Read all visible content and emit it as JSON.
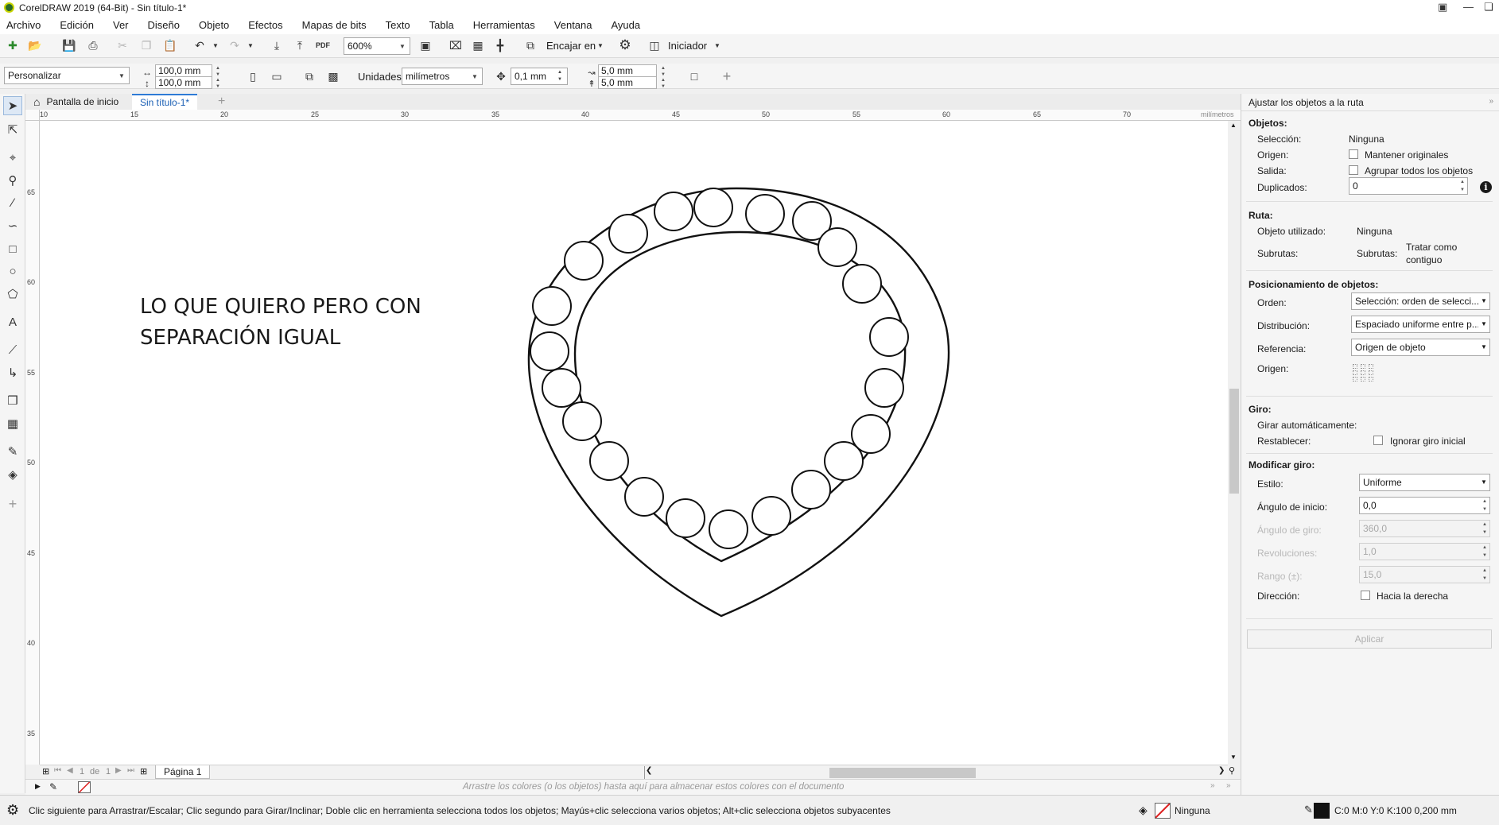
{
  "window": {
    "title": "CorelDRAW 2019 (64-Bit) - Sin título-1*"
  },
  "menu": [
    "Archivo",
    "Edición",
    "Ver",
    "Diseño",
    "Objeto",
    "Efectos",
    "Mapas de bits",
    "Texto",
    "Tabla",
    "Herramientas",
    "Ventana",
    "Ayuda"
  ],
  "toolbar": {
    "zoom": "600%",
    "pdf_label": "PDF",
    "snap_label": "Encajar en",
    "launcher_label": "Iniciador"
  },
  "property_bar": {
    "preset": "Personalizar",
    "width": "100,0 mm",
    "height": "100,0 mm",
    "units_label": "Unidades:",
    "units_value": "milímetros",
    "nudge": "0,1 mm",
    "dup_x": "5,0 mm",
    "dup_y": "5,0 mm"
  },
  "tabs": {
    "home": "Pantalla de inicio",
    "document": "Sin título-1*"
  },
  "ruler": {
    "h_ticks": [
      "10",
      "15",
      "20",
      "25",
      "30",
      "35",
      "40",
      "45",
      "50",
      "55",
      "60",
      "65",
      "70"
    ],
    "units": "milímetros",
    "v_ticks": [
      "65",
      "60",
      "55",
      "50",
      "45",
      "40",
      "35"
    ]
  },
  "canvas": {
    "line1": "LO QUE QUIERO PERO CON",
    "line2": "SEPARACIÓN IGUAL"
  },
  "page_nav": {
    "current": "1",
    "of": "de",
    "total": "1",
    "page_tab": "Página 1"
  },
  "palette_hint": "Arrastre los colores (o los objetos) hasta aquí para almacenar estos colores con el documento",
  "status": {
    "hint": "Clic siguiente para Arrastrar/Escalar; Clic segundo para Girar/Inclinar; Doble clic en herramienta selecciona todos los objetos; Mayús+clic selecciona varios objetos; Alt+clic selecciona objetos subyacentes",
    "fill": "Ninguna",
    "outline": "C:0 M:0 Y:0 K:100  0,200 mm"
  },
  "docker": {
    "title": "Ajustar los objetos a la ruta",
    "objetos": {
      "heading": "Objetos:",
      "seleccion_label": "Selección:",
      "seleccion_value": "Ninguna",
      "origen_label": "Origen:",
      "origen_check": "Mantener originales",
      "salida_label": "Salida:",
      "salida_check": "Agrupar todos los objetos",
      "duplicados_label": "Duplicados:",
      "duplicados_value": "0"
    },
    "ruta": {
      "heading": "Ruta:",
      "objeto_label": "Objeto utilizado:",
      "objeto_value": "Ninguna",
      "subrutas_label": "Subrutas:",
      "subrutas_label2": "Subrutas:",
      "subrutas_value1": "Tratar como",
      "subrutas_value2": "contiguo"
    },
    "posicionamiento": {
      "heading": "Posicionamiento de objetos:",
      "orden_label": "Orden:",
      "orden_value": "Selección: orden de selecci...",
      "distribucion_label": "Distribución:",
      "distribucion_value": "Espaciado uniforme entre p...",
      "referencia_label": "Referencia:",
      "referencia_value": "Origen de objeto",
      "origen_label": "Origen:"
    },
    "giro": {
      "heading": "Giro:",
      "auto_label": "Girar automáticamente:",
      "restablecer_label": "Restablecer:",
      "restablecer_check": "Ignorar giro inicial"
    },
    "modificar": {
      "heading": "Modificar giro:",
      "estilo_label": "Estilo:",
      "estilo_value": "Uniforme",
      "inicio_label": "Ángulo de inicio:",
      "inicio_value": "0,0",
      "giro_label": "Ángulo de giro:",
      "giro_value": "360,0",
      "rev_label": "Revoluciones:",
      "rev_value": "1,0",
      "rango_label": "Rango (±):",
      "rango_value": "15,0",
      "direccion_label": "Dirección:",
      "direccion_check": "Hacia la derecha"
    },
    "apply": "Aplicar"
  }
}
